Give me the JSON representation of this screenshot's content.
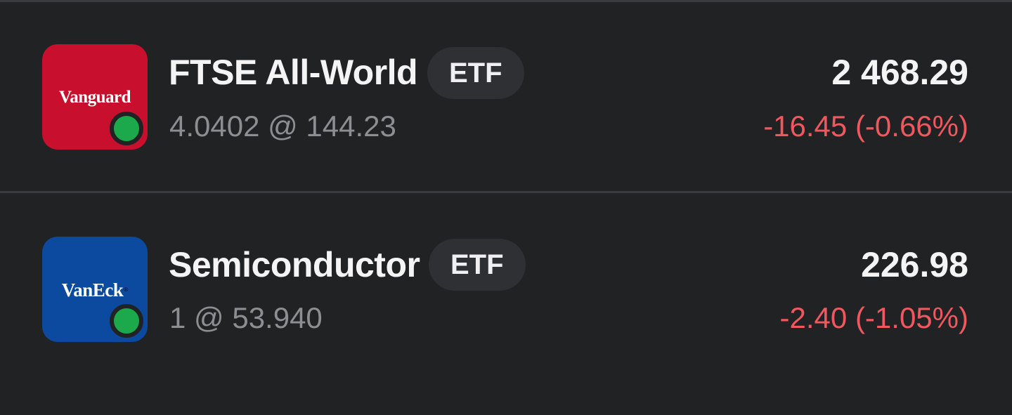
{
  "holdings": [
    {
      "logo_text": "Vanguard",
      "logo_color": "#c8102e",
      "name": "FTSE All-World",
      "type_badge": "ETF",
      "quantity_price": "4.0402 @ 144.23",
      "value": "2 468.29",
      "change": "-16.45 (-0.66%)",
      "status": "active",
      "status_color": "#1ba94c"
    },
    {
      "logo_text": "VanEck",
      "logo_color": "#0b4a9f",
      "name": "Semiconductor",
      "type_badge": "ETF",
      "quantity_price": "1 @ 53.940",
      "value": "226.98",
      "change": "-2.40 (-1.05%)",
      "status": "active",
      "status_color": "#1ba94c"
    }
  ],
  "colors": {
    "background": "#212224",
    "negative_change": "#f0585f",
    "badge_background": "#2f3034"
  }
}
